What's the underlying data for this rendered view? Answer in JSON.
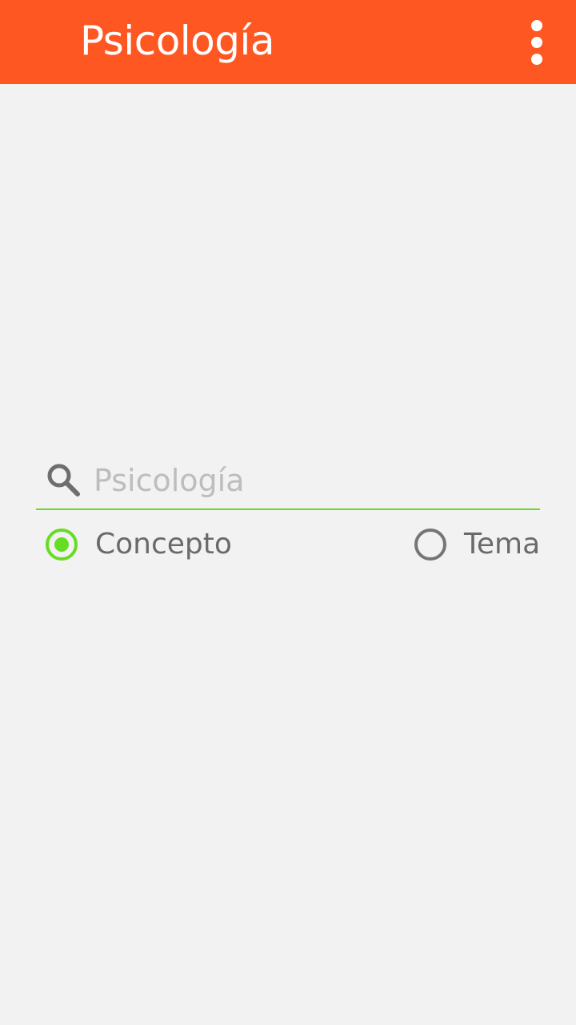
{
  "app_bar": {
    "title": "Psicología",
    "background_color": "#ff5722",
    "menu_icon": "more-vert-icon"
  },
  "search": {
    "icon": "search-icon",
    "placeholder": "Psicología",
    "value": "",
    "underline_color": "#66dd22"
  },
  "search_type": {
    "options": [
      {
        "label": "Concepto",
        "selected": true
      },
      {
        "label": "Tema",
        "selected": false
      }
    ],
    "accent_color": "#66dd22"
  }
}
